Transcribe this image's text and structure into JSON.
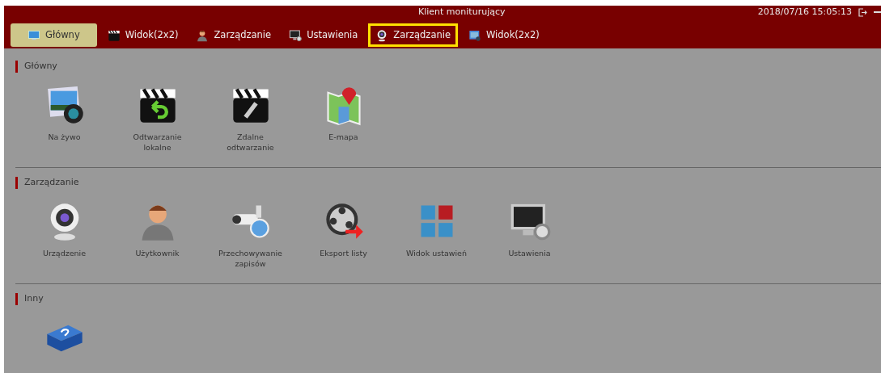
{
  "window": {
    "title": "Klient moniturujący",
    "datetime": "2018/07/16 15:05:13"
  },
  "tabs": [
    {
      "label": "Główny",
      "kind": "monitor",
      "selected": true,
      "highlighted": false
    },
    {
      "label": "Widok(2x2)",
      "kind": "clapper",
      "selected": false,
      "highlighted": false
    },
    {
      "label": "Zarządzanie",
      "kind": "person",
      "selected": false,
      "highlighted": false
    },
    {
      "label": "Ustawienia",
      "kind": "screen",
      "selected": false,
      "highlighted": false
    },
    {
      "label": "Zarządzanie",
      "kind": "webcam",
      "selected": false,
      "highlighted": true
    },
    {
      "label": "Widok(2x2)",
      "kind": "view",
      "selected": false,
      "highlighted": false
    }
  ],
  "sections": [
    {
      "title": "Główny",
      "items": [
        {
          "label": "Na żywo",
          "kind": "photo"
        },
        {
          "label": "Odtwarzanie lokalne",
          "kind": "replay"
        },
        {
          "label": "Zdalne odtwarzanie",
          "kind": "remote"
        },
        {
          "label": "E-mapa",
          "kind": "map"
        }
      ]
    },
    {
      "title": "Zarządzanie",
      "items": [
        {
          "label": "Urządzenie",
          "kind": "webcam"
        },
        {
          "label": "Użytkownik",
          "kind": "person"
        },
        {
          "label": "Przechowywanie zapisów",
          "kind": "camera"
        },
        {
          "label": "Eksport listy",
          "kind": "reel"
        },
        {
          "label": "Widok ustawień",
          "kind": "grid"
        },
        {
          "label": "Ustawienia",
          "kind": "screen"
        }
      ]
    },
    {
      "title": "Inny",
      "items": [
        {
          "kind": "book"
        }
      ]
    }
  ]
}
